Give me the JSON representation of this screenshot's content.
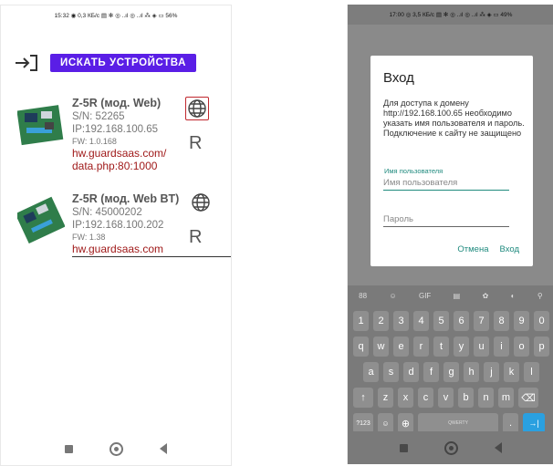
{
  "left": {
    "status": "15:32 ◉  0,3 КБ/с ▤ ✻ ◎ ..ıl ◎ ..ıl ⁂ ◈ ▭ 56%",
    "search_button": "ИСКАТЬ УСТРОЙСТВА",
    "devices": [
      {
        "name": "Z-5R (мод. Web)",
        "sn": "S/N: 52265",
        "ip": "IP:192.168.100.65",
        "fw": "FW: 1.0.168",
        "link1": "hw.guardsaas.com/",
        "link2": "data.php:80:1000",
        "r_label": "R"
      },
      {
        "name": "Z-5R (мод. Web BT)",
        "sn": "S/N: 45000202",
        "ip": "IP:192.168.100.202",
        "fw": "FW: 1.38",
        "link1": "hw.guardsaas.com",
        "r_label": "R"
      }
    ]
  },
  "right": {
    "status": "17:00 ◎  3,5 КБ/с ▤ ✻ ◎ ..ıl ◎ ..ıl ⁂ ◈ ▭ 49%",
    "dialog": {
      "title": "Вход",
      "message": "Для доступа к домену http://192.168.100.65 необходимо указать имя пользователя и пароль. Подключение к сайту не защищено",
      "username_label": "Имя пользователя",
      "username_placeholder": "Имя пользователя",
      "password_placeholder": "Пароль",
      "cancel": "Отмена",
      "login": "Вход"
    },
    "keyboard": {
      "toolbar": [
        "88",
        "☺",
        "GIF",
        "▤",
        "✿",
        "◐",
        "⚲"
      ],
      "row_numbers": [
        "1",
        "2",
        "3",
        "4",
        "5",
        "6",
        "7",
        "8",
        "9",
        "0"
      ],
      "row1": [
        "q",
        "w",
        "e",
        "r",
        "t",
        "y",
        "u",
        "i",
        "o",
        "p"
      ],
      "row2": [
        "a",
        "s",
        "d",
        "f",
        "g",
        "h",
        "j",
        "k",
        "l"
      ],
      "row3": [
        "↑",
        "z",
        "x",
        "c",
        "v",
        "b",
        "n",
        "m",
        "⌫"
      ],
      "row4": [
        "?123",
        "☺",
        "⊕",
        "QWERTY",
        ".",
        "→|"
      ]
    }
  },
  "colors": {
    "accent": "#5a1ee6",
    "link": "#a01a1a",
    "highlight": "#c0272d",
    "dialog_accent": "#1f8a7e"
  }
}
